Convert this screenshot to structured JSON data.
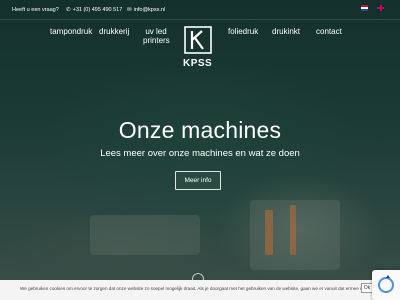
{
  "topbar": {
    "question": "Heeft u een vraag?",
    "phone": "+31 (0) 495 490 517",
    "email": "info@kpss.nl",
    "flags": [
      "nl-flag-icon",
      "en-flag-icon"
    ]
  },
  "nav": {
    "left": [
      "tampondruk",
      "drukkerij",
      "uv led printers"
    ],
    "right": [
      "foliedruk",
      "drukinkt",
      "contact"
    ],
    "logo_text": "KPSS"
  },
  "hero": {
    "title": "Onze machines",
    "subtitle": "Lees meer over onze machines en wat ze doen",
    "button": "Meer info"
  },
  "cookie": {
    "text": "We gebruiken cookies om ervoor te zorgen dat onze website zo soepel mogelijk draait. Als je doorgaat met het gebruiken van de website, gaan we er vanuit dat ermee instemt.",
    "ok": "Ok"
  },
  "colors": {
    "background": "#17332e",
    "accent": "#ffffff",
    "cookie_bar": "#f4f4f4"
  }
}
